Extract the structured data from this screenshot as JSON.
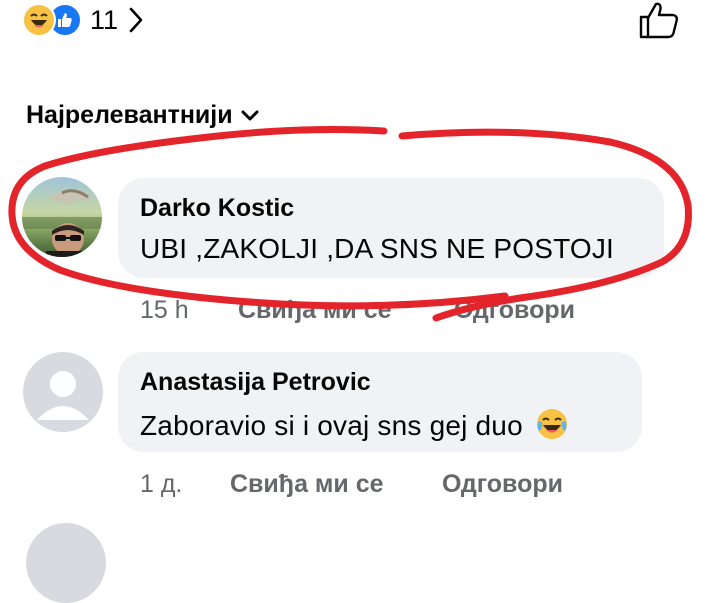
{
  "reactions": {
    "emoji_icon": "laughing-face-icon",
    "like_icon": "thumbs-up-icon",
    "count": "11"
  },
  "sort": {
    "label": "Најрелевантнији"
  },
  "comments": [
    {
      "author": "Darko Kostic",
      "text": "UBI ,ZAKOLJI ,DA SNS NE POSTOJI",
      "time": "15 h",
      "like_label": "Свиђа ми се",
      "reply_label": "Одговори"
    },
    {
      "author": "Anastasija Petrovic",
      "text": "Zaboravio si i ovaj sns gej duo",
      "time": "1 д.",
      "like_label": "Свиђа ми се",
      "reply_label": "Одговори"
    }
  ],
  "colors": {
    "bubble": "#f0f2f5",
    "secondary_text": "#65676b",
    "annotation_red": "#e3242b",
    "like_blue": "#1877f2"
  }
}
